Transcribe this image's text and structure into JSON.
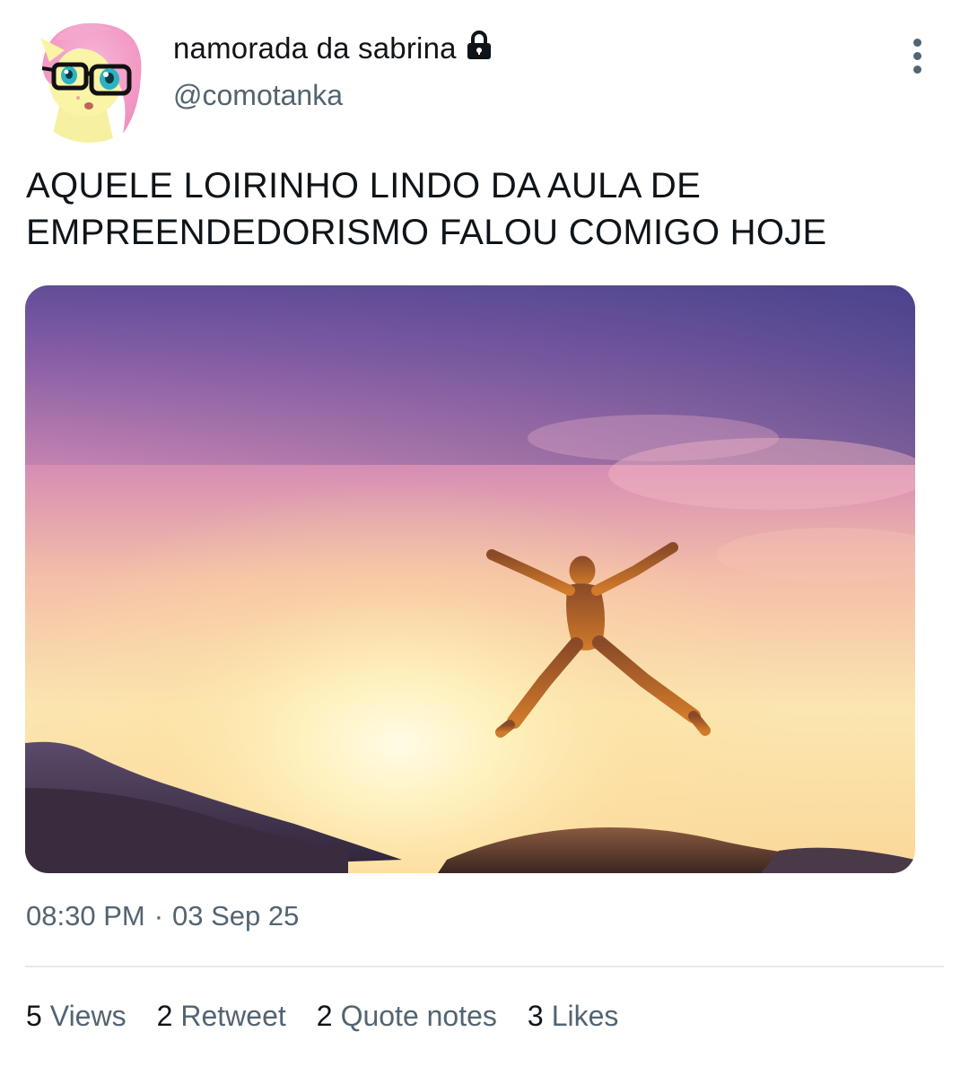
{
  "author": {
    "display_name": "namorada da sabrina",
    "handle": "@comotanka",
    "avatar_icon": "pony-avatar-icon",
    "lock_icon": "lock-icon"
  },
  "tweet": {
    "text_lines": [
      "AQUELE LOIRINHO LINDO DA AULA DE",
      "EMPREENDEDORISMO FALOU COMIGO HOJE"
    ],
    "media_icon": "sunset-jumping-person-photo",
    "time": "08:30 PM",
    "separator": "·",
    "date": "03 Sep 25"
  },
  "stats": [
    {
      "num": "5",
      "label": "Views"
    },
    {
      "num": "2",
      "label": "Retweet"
    },
    {
      "num": "2",
      "label": "Quote notes"
    },
    {
      "num": "3",
      "label": "Likes"
    }
  ],
  "colors": {
    "text": "#0f1419",
    "secondary": "#536471",
    "divider": "#e6e9eb"
  }
}
